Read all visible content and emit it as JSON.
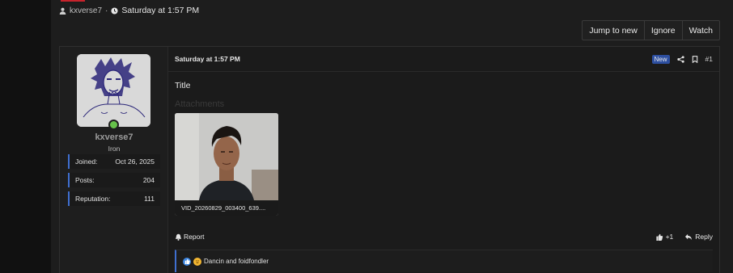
{
  "thread_meta": {
    "author": "kxverse7",
    "separator": "·",
    "date": "Saturday at 1:57 PM"
  },
  "toolbar": {
    "jump_label": "Jump to new",
    "ignore_label": "Ignore",
    "watch_label": "Watch"
  },
  "user": {
    "name": "kxverse7",
    "title": "Iron",
    "stats": [
      {
        "label": "Joined:",
        "value": "Oct 26, 2025"
      },
      {
        "label": "Posts:",
        "value": "204"
      },
      {
        "label": "Reputation:",
        "value": "111"
      }
    ]
  },
  "post": {
    "date": "Saturday at 1:57 PM",
    "new_badge": "New",
    "number": "#1",
    "title": "Title",
    "attachments_label": "Attachments",
    "attachment_name": "VID_20260829_003400_639....",
    "report_label": "Report",
    "like_label": "+1",
    "reply_label": "Reply",
    "reactions_text": "Dancin and foidfondler"
  },
  "colors": {
    "accent": "#3f6fd0",
    "badge": "#2d4fa0",
    "online": "#66c24a",
    "brand_red": "#c8232c"
  }
}
